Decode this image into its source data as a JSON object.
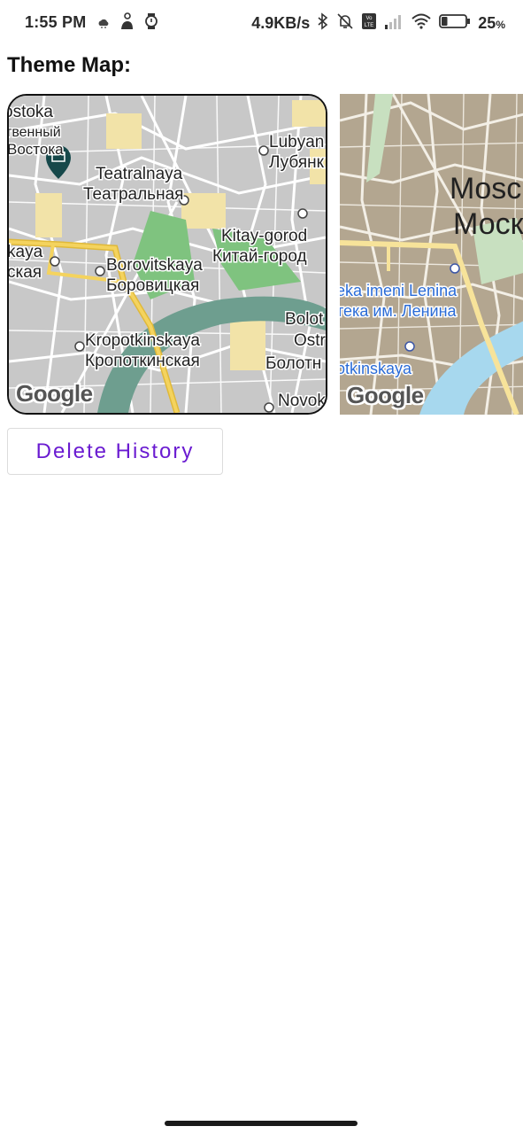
{
  "status_bar": {
    "time": "1:55 PM",
    "network_speed": "4.9KB/s",
    "battery_percent": "25",
    "battery_unit": "%",
    "battery_level": 0.25,
    "icons_left": [
      "cloud-icon",
      "person-icon",
      "watch-icon"
    ],
    "icons_right": [
      "bluetooth-icon",
      "bell-off-icon",
      "volte-icon",
      "signal-icon",
      "wifi-icon",
      "battery-icon"
    ]
  },
  "header": {
    "title": "Theme Map:"
  },
  "maps": [
    {
      "style": "standard",
      "labels": {
        "top_left_1": "ostoka",
        "top_left_2": "твенный",
        "top_left_3": "Востока",
        "lubyanka_en": "Lubyan",
        "lubyanka_ru": "Лубянк",
        "teatralnaya_en": "Teatralnaya",
        "teatralnaya_ru": "Театральная",
        "kitay_en": "Kitay-gorod",
        "kitay_ru": "Китай-город",
        "kaya_en": "kaya",
        "kaya_ru": "ская",
        "borovitskaya_en": "Borovitskaya",
        "borovitskaya_ru": "Боровицкая",
        "bolot_en": "Bolot",
        "ostr": "Ostr",
        "bolot_ru": "Болотн",
        "kropotkinskaya_en": "Kropotkinskaya",
        "kropotkinskaya_ru": "Кропоткинская",
        "novok": "Novok"
      },
      "attribution": "Google"
    },
    {
      "style": "dark-beige",
      "labels": {
        "mosc_en": "Mosc",
        "mosc_ru": "Моск",
        "lenina_en": "eka imeni Lenina",
        "lenina_ru": "тека им. Ленина",
        "kropotkinskaya_en": "otkinskaya"
      },
      "attribution": "Google"
    }
  ],
  "actions": {
    "delete_history_label": "Delete History"
  },
  "colors": {
    "button_text": "#6a1bd1",
    "map_park": "#7fc37f",
    "map_road_major": "#f0c94a",
    "map_water": "#6e9e8f",
    "map2_base": "#b3a690",
    "map2_water": "#a7d8ee"
  }
}
